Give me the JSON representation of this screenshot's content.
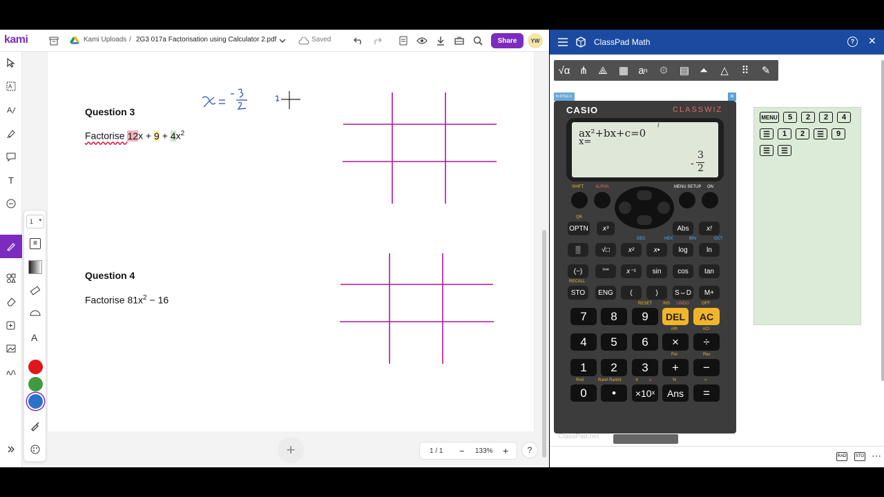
{
  "kami": {
    "logo": "kami",
    "breadcrumb_root": "Kami Uploads",
    "breadcrumb_sep": "/",
    "file_name": "2G3 017a Factorisation using Calculator 2.pdf",
    "save_status": "Saved",
    "share_label": "Share",
    "avatar_initials": "YW",
    "page_select": "1",
    "question3": {
      "title": "Question 3",
      "prefix": "Factorise ",
      "t1": "12",
      "t1b": "x",
      "op1": " + ",
      "t2": "9",
      "op2": " + ",
      "t3": "4",
      "t3b": "x",
      "exp": "2"
    },
    "question4": {
      "title": "Question 4",
      "text": "Factorise 81x",
      "exp": "2",
      "tail": " − 16"
    },
    "pager": {
      "page": "1 / 1",
      "zoom": "133%",
      "minus": "−",
      "plus": "+"
    },
    "help": "?",
    "add": "+",
    "colors": {
      "accent": "#7b2cbf",
      "pen_red": "#e0161b",
      "pen_green": "#3e9c3e",
      "pen_blue": "#2a72c8",
      "grid": "#b0149a",
      "ink": "#3a5ec8"
    }
  },
  "classpad": {
    "title": "ClassPad Math",
    "calc_model": "fx-97SG X",
    "brand": "CASIO",
    "series": "CLASSWIZ",
    "screen_line1": "ax²+bx+c=0",
    "screen_line2": "x=",
    "screen_indicator": "i",
    "result_sign": "-",
    "result_num": "3",
    "result_den": "2",
    "labels": {
      "shift": "SHIFT",
      "alpha": "ALPHA",
      "menu": "MENU SETUP",
      "on": "ON",
      "qr": "QR",
      "reset": "RESET",
      "ins": "INS",
      "undo": "UNDO",
      "off": "OFF",
      "recall": "RECALL",
      "npr": "nPr",
      "ncr": "nCr",
      "pol": "Pol",
      "rec": "Rec",
      "rnd": "Rnd",
      "ranint": "Ran# RanInt",
      "pi": "π",
      "e": "e",
      "pct": "%",
      "approx": "≈",
      "dec": "DEC",
      "hex": "HEX",
      "bin": "BIN",
      "oct": "OCT"
    },
    "fn_row1": [
      "OPTN",
      "x³",
      "Abs",
      "x!"
    ],
    "fn_row2": [
      "▒",
      "√□",
      "x²",
      "x▪",
      "log",
      "ln"
    ],
    "fn_row3": [
      "(−)",
      "°′″",
      "x⁻¹",
      "sin",
      "cos",
      "tan"
    ],
    "fn_row4": [
      "STO",
      "ENG",
      "(",
      ")",
      "S⇔D",
      "M+"
    ],
    "num_row1": [
      "7",
      "8",
      "9",
      "DEL",
      "AC"
    ],
    "num_row2": [
      "4",
      "5",
      "6",
      "×",
      "÷"
    ],
    "num_row3": [
      "1",
      "2",
      "3",
      "+",
      "−"
    ],
    "num_row4": [
      "0",
      "•",
      "×10ˣ",
      "Ans",
      "="
    ],
    "history_row1": [
      "MENU",
      "5",
      "2",
      "2",
      "4"
    ],
    "history_row2": [
      "☰",
      "1",
      "2",
      "☰",
      "9"
    ],
    "history_row3": [
      "☰",
      "☰"
    ],
    "footer_watermark": "ClassPad.net",
    "mode_rad": "RAD",
    "mode_sto": "STO"
  },
  "annotation": {
    "text": "x = -3/2"
  }
}
